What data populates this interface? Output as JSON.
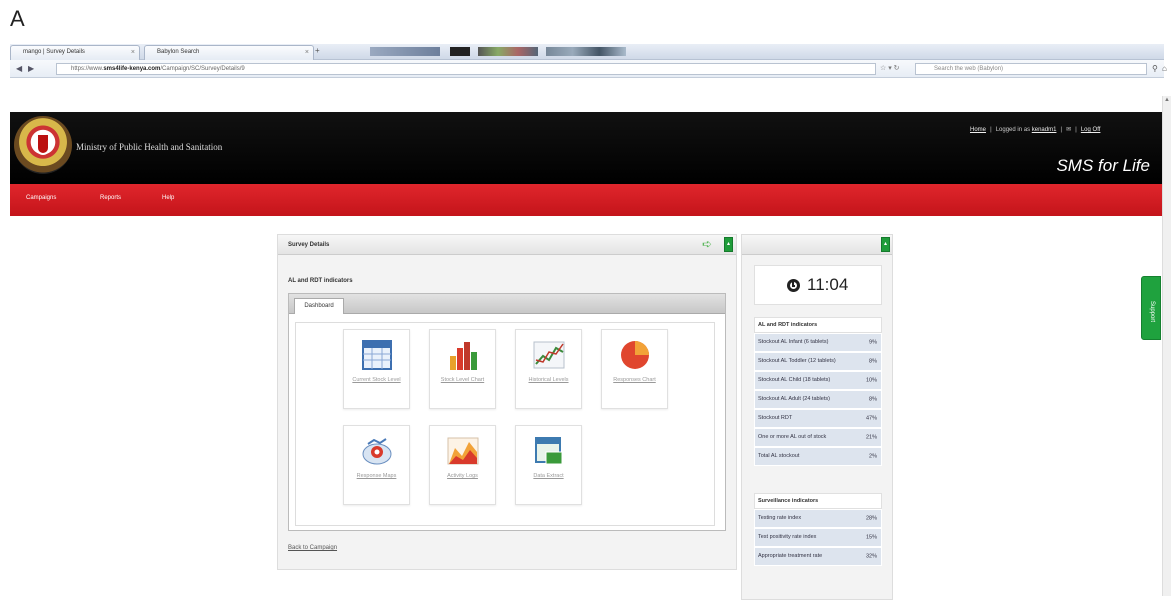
{
  "figure_label": "A",
  "browser": {
    "tabs": [
      {
        "title": "mango | Survey Details"
      },
      {
        "title": "Babylon Search"
      }
    ],
    "new_tab": "+",
    "url_domain": "sms4life-kenya.com",
    "url_prefix": "https://www.",
    "url_path": "/Campaign/SC/Survey/Details/9",
    "search_placeholder": "Search the web (Babylon)"
  },
  "header": {
    "ministry": "Ministry of Public Health and Sanitation",
    "links": {
      "home": "Home",
      "logged_in": "Logged in as",
      "user": "kenadm1",
      "logoff": "Log Off"
    },
    "brand": "SMS for Life"
  },
  "nav": {
    "items": [
      "Campaigns",
      "Reports",
      "Help"
    ]
  },
  "main": {
    "title": "Survey Details",
    "section_title": "AL and RDT indicators",
    "tab_label": "Dashboard",
    "tiles": [
      {
        "label": "Current Stock Level",
        "icon": "table-icon"
      },
      {
        "label": "Stock Level Chart",
        "icon": "bar-chart-icon"
      },
      {
        "label": "Historical Levels",
        "icon": "line-chart-icon"
      },
      {
        "label": "Responses Chart",
        "icon": "pie-chart-icon"
      },
      {
        "label": "Response Maps",
        "icon": "map-icon"
      },
      {
        "label": "Activity Logs",
        "icon": "area-chart-icon"
      },
      {
        "label": "Data Extract",
        "icon": "data-extract-icon"
      }
    ],
    "back_link": "Back to Campaign"
  },
  "side": {
    "time": "11:04",
    "al_rdt": {
      "title": "AL and RDT indicators",
      "rows": [
        {
          "label": "Stockout AL Infant (6 tablets)",
          "value": "9%"
        },
        {
          "label": "Stockout AL Toddler (12 tablets)",
          "value": "8%"
        },
        {
          "label": "Stockout AL Child (18 tablets)",
          "value": "10%"
        },
        {
          "label": "Stockout AL Adult (24 tablets)",
          "value": "8%"
        },
        {
          "label": "Stockout RDT",
          "value": "47%"
        },
        {
          "label": "One or more AL out of stock",
          "value": "21%"
        },
        {
          "label": "Total AL stockout",
          "value": "2%"
        }
      ]
    },
    "surveillance": {
      "title": "Surveillance indicators",
      "rows": [
        {
          "label": "Testing rate index",
          "value": "28%"
        },
        {
          "label": "Test positivity rate index",
          "value": "15%"
        },
        {
          "label": "Appropriate treatment rate",
          "value": "32%"
        }
      ]
    }
  },
  "support": "Support",
  "colors": {
    "red": "#d11e24",
    "green": "#1f9c3a",
    "header": "#000000"
  }
}
